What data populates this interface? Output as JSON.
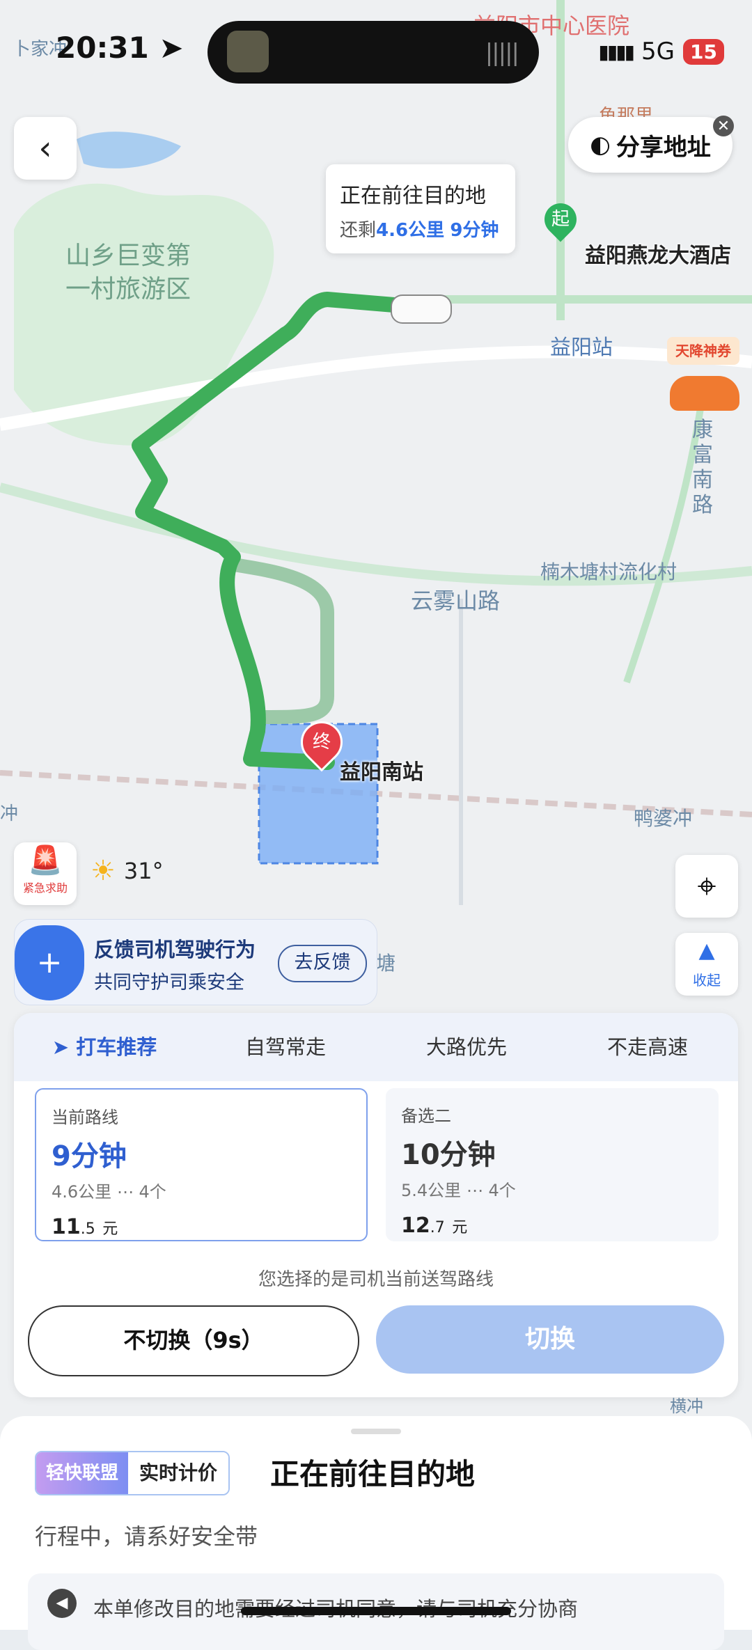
{
  "status_bar": {
    "time": "20:31",
    "network": "5G",
    "battery": "15"
  },
  "map": {
    "labels": {
      "hospital": "益阳市中心医院",
      "area_name_line1": "山乡巨变第",
      "area_name_line2": "一村旅游区",
      "start_poi": "益阳燕龙大酒店",
      "station": "益阳站",
      "road_kangfu": "康富南路",
      "village": "楠木塘村流化村",
      "road_yunwu": "云雾山路",
      "dest_poi": "益阳南站",
      "yapochong": "鸭婆冲",
      "left_edge": "卜家冲",
      "left_edge2": "冲",
      "tang": "塘",
      "bottom_right": "横冲",
      "poi_partial": "鱼那里"
    },
    "bubble": {
      "title": "正在前往目的地",
      "prefix": "还剩",
      "distance": "4.6公里",
      "time": "9分钟"
    },
    "start_marker": "起",
    "end_marker": "终",
    "share_label": "分享地址",
    "promo_tag": "天降神券",
    "route_color": "#3fae5a",
    "alt_route_color": "#9cc9a8",
    "highlight_color": "#7aaef5"
  },
  "controls": {
    "sos_label": "紧急求助",
    "weather_temp": "31°",
    "collapse_label": "收起"
  },
  "feedback": {
    "title": "反馈司机驾驶行为",
    "subtitle": "共同守护司乘安全",
    "button": "去反馈"
  },
  "route_panel": {
    "tabs": [
      "打车推荐",
      "自驾常走",
      "大路优先",
      "不走高速"
    ],
    "current": {
      "name": "当前路线",
      "duration": "9分钟",
      "distance": "4.6公里",
      "lights": "4个",
      "price_int": "11",
      "price_dec": ".5",
      "unit": "元"
    },
    "alternative": {
      "name": "备选二",
      "duration": "10分钟",
      "distance": "5.4公里",
      "lights": "4个",
      "price_int": "12",
      "price_dec": ".7",
      "unit": "元"
    },
    "note": "您选择的是司机当前送驾路线",
    "keep_button": "不切换（9s）",
    "switch_button": "切换"
  },
  "sheet": {
    "brand_primary": "轻快联盟",
    "brand_secondary": "实时计价",
    "title": "正在前往目的地",
    "subtitle": "行程中，请系好安全带",
    "notice": "本单修改目的地需要经过司机同意，请与司机充分协商"
  }
}
